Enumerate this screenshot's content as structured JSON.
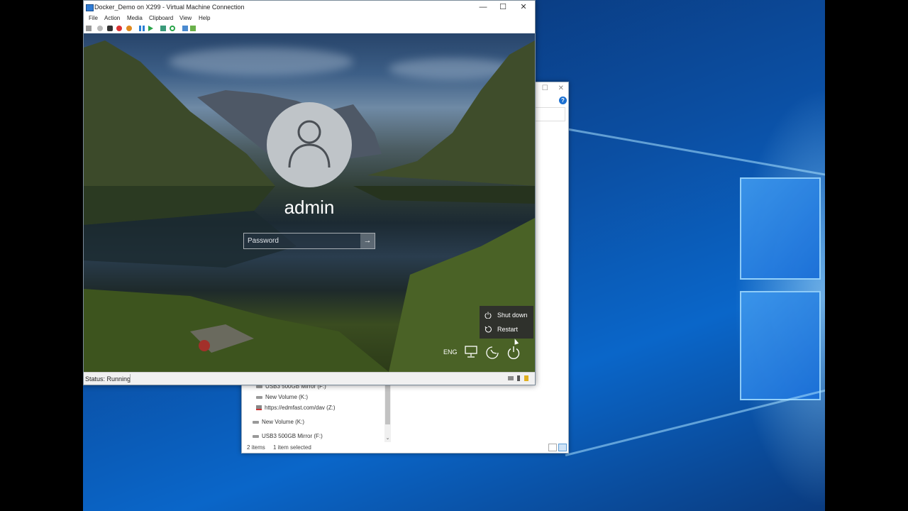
{
  "vm_window": {
    "title": "Docker_Demo on X299 - Virtual Machine Connection",
    "menu": [
      "File",
      "Action",
      "Media",
      "Clipboard",
      "View",
      "Help"
    ],
    "status": "Status: Running"
  },
  "lock_screen": {
    "username": "admin",
    "password_placeholder": "Password",
    "power_menu": [
      "Shut down",
      "Restart"
    ],
    "language": "ENG"
  },
  "explorer": {
    "tree": [
      "USB3 500GB Mirror (F:)",
      "New Volume (K:)",
      "https://edmfast.com/dav (Z:)",
      "New Volume (K:)",
      "USB3 500GB Mirror (F:)"
    ],
    "status_items": "2 items",
    "status_selected": "1 item selected"
  },
  "colors": {
    "accent": "#0a66c9",
    "help": "#1a6fd1"
  }
}
